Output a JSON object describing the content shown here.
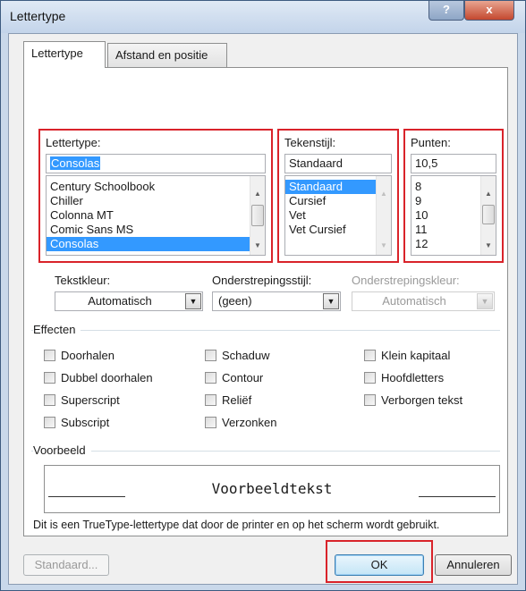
{
  "window": {
    "title": "Lettertype",
    "help_label": "?",
    "close_label": "x"
  },
  "tabs": [
    {
      "label": "Lettertype",
      "active": true
    },
    {
      "label": "Afstand en positie",
      "active": false
    }
  ],
  "font": {
    "label": "Lettertype:",
    "value": "Consolas",
    "items": [
      "Century Schoolbook",
      "Chiller",
      "Colonna MT",
      "Comic Sans MS",
      "Consolas"
    ],
    "selected_index": 4
  },
  "style": {
    "label": "Tekenstijl:",
    "value": "Standaard",
    "items": [
      "Standaard",
      "Cursief",
      "Vet",
      "Vet Cursief"
    ],
    "selected_index": 0
  },
  "size": {
    "label": "Punten:",
    "value": "10,5",
    "items": [
      "8",
      "9",
      "10",
      "11",
      "12"
    ]
  },
  "color": {
    "label": "Tekstkleur:",
    "value": "Automatisch"
  },
  "underline_style": {
    "label": "Onderstrepingsstijl:",
    "value": "(geen)"
  },
  "underline_color": {
    "label": "Onderstrepingskleur:",
    "value": "Automatisch"
  },
  "effects": {
    "title": "Effecten",
    "col1": [
      "Doorhalen",
      "Dubbel doorhalen",
      "Superscript",
      "Subscript"
    ],
    "col2": [
      "Schaduw",
      "Contour",
      "Reliëf",
      "Verzonken"
    ],
    "col3": [
      "Klein kapitaal",
      "Hoofdletters",
      "Verborgen tekst"
    ]
  },
  "preview": {
    "title": "Voorbeeld",
    "text": "Voorbeeldtekst",
    "description": "Dit is een TrueType-lettertype dat door de printer en op het scherm wordt gebruikt."
  },
  "buttons": {
    "default": "Standaard...",
    "ok": "OK",
    "cancel": "Annuleren"
  },
  "colors": {
    "highlight": "#d9232a",
    "selection": "#3399ff"
  },
  "icons": {
    "scroll_up": "▲",
    "scroll_down": "▼",
    "dropdown": "▼"
  }
}
